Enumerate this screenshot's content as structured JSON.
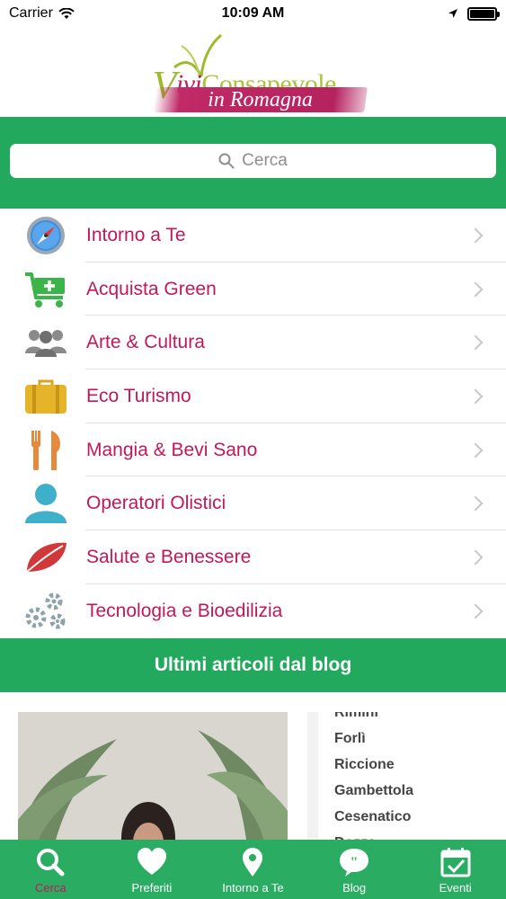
{
  "status_bar": {
    "carrier": "Carrier",
    "time": "10:09 AM"
  },
  "logo": {
    "top_v": "V",
    "top_ivi": "ivi",
    "top_rest": "Consapevole",
    "bottom": "in Romagna"
  },
  "search": {
    "placeholder": "Cerca"
  },
  "menu": {
    "items": [
      {
        "label": "Intorno a Te",
        "icon": "compass-icon"
      },
      {
        "label": "Acquista Green",
        "icon": "cart-icon"
      },
      {
        "label": "Arte & Cultura",
        "icon": "people-icon"
      },
      {
        "label": "Eco Turismo",
        "icon": "suitcase-icon"
      },
      {
        "label": "Mangia & Bevi Sano",
        "icon": "fork-knife-icon"
      },
      {
        "label": "Operatori Olistici",
        "icon": "person-icon"
      },
      {
        "label": "Salute e Benessere",
        "icon": "leaf-icon"
      },
      {
        "label": "Tecnologia e Bioedilizia",
        "icon": "gears-icon"
      }
    ]
  },
  "blog": {
    "header": "Ultimi articoli dal blog",
    "places": [
      "Rimini",
      "Forlì",
      "Riccione",
      "Gambettola",
      "Cesenatico",
      "Dozza"
    ]
  },
  "tabs": [
    {
      "label": "Cerca",
      "icon": "search-icon",
      "active": true
    },
    {
      "label": "Preferiti",
      "icon": "heart-icon",
      "active": false
    },
    {
      "label": "Intorno a Te",
      "icon": "map-pin-icon",
      "active": false
    },
    {
      "label": "Blog",
      "icon": "quote-bubble-icon",
      "active": false
    },
    {
      "label": "Eventi",
      "icon": "calendar-icon",
      "active": false
    }
  ],
  "colors": {
    "green": "#23a95e",
    "magenta": "#c2185b",
    "tab_active": "#c2185b"
  }
}
